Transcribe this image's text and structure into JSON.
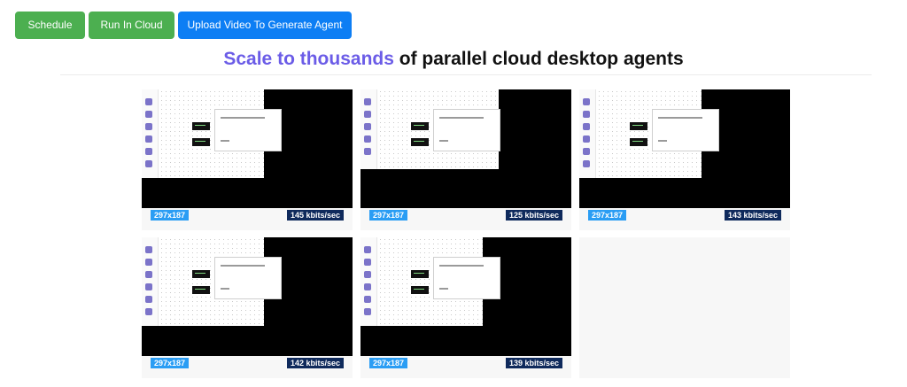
{
  "toolbar": {
    "schedule_label": "Schedule",
    "run_cloud_label": "Run In Cloud",
    "upload_label": "Upload Video To Generate Agent"
  },
  "headline": {
    "accent": "Scale to thousands",
    "rest": " of parallel cloud desktop agents"
  },
  "colors": {
    "green_button": "#4caf50",
    "blue_button": "#0d7ef4",
    "accent": "#6b5ce7",
    "resolution_badge": "#2a9df4",
    "bitrate_badge": "#0f2a5c"
  },
  "agents": [
    {
      "resolution": "297x187",
      "bitrate": "145 kbits/sec"
    },
    {
      "resolution": "297x187",
      "bitrate": "125 kbits/sec"
    },
    {
      "resolution": "297x187",
      "bitrate": "143 kbits/sec"
    },
    {
      "resolution": "297x187",
      "bitrate": "142 kbits/sec"
    },
    {
      "resolution": "297x187",
      "bitrate": "139 kbits/sec"
    }
  ]
}
